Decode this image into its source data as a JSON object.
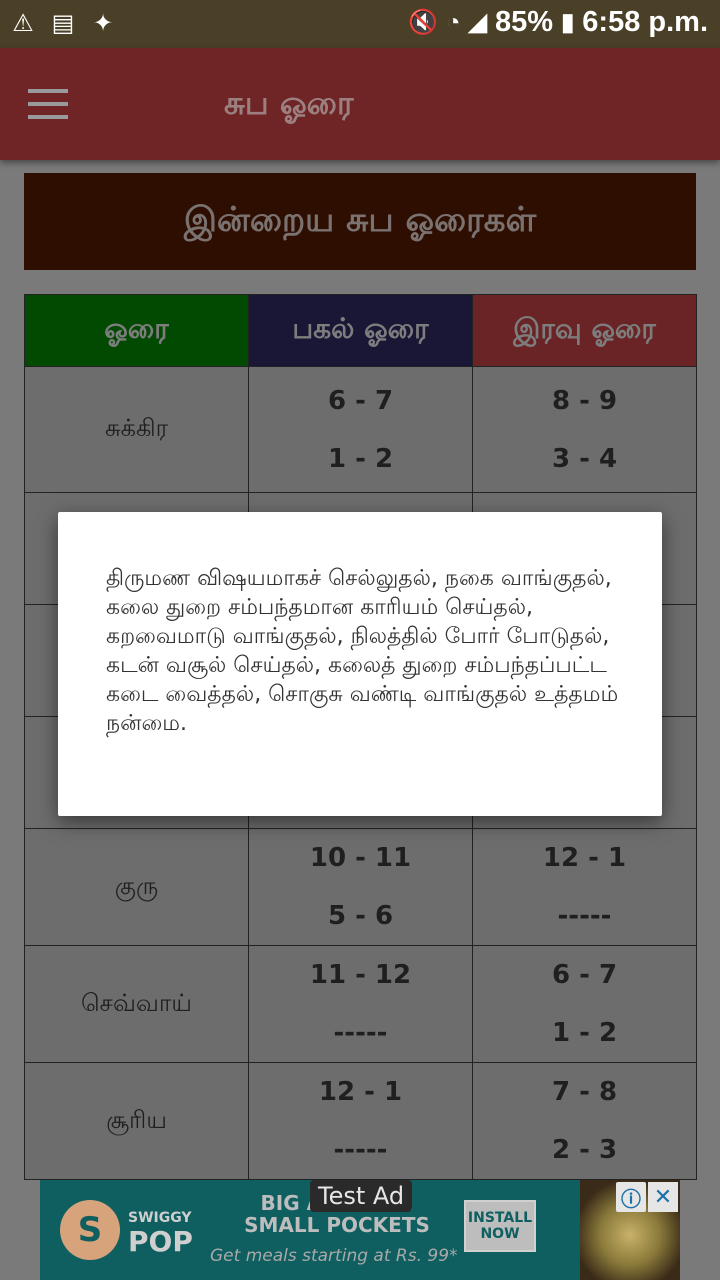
{
  "status_bar": {
    "icons_left": [
      "warning-icon",
      "document-icon",
      "magic-wand-icon"
    ],
    "battery": "85%",
    "time": "6:58 p.m."
  },
  "app_bar": {
    "title": "சுப ஓரை"
  },
  "banner": {
    "title": "இன்றைய சுப ஓரைகள்"
  },
  "table": {
    "headers": [
      "ஓரை",
      "பகல் ஓரை",
      "இரவு ஓரை"
    ],
    "header_colors": [
      "#024a02",
      "#191636",
      "#6a2426"
    ],
    "rows": [
      {
        "planet": "சுக்கிர",
        "day": [
          "6 - 7",
          "1 - 2"
        ],
        "night": [
          "8 - 9",
          "3 - 4"
        ]
      },
      {
        "planet": "",
        "day": [
          "",
          ""
        ],
        "night": [
          "",
          ""
        ]
      },
      {
        "planet": "",
        "day": [
          "",
          ""
        ],
        "night": [
          "",
          ""
        ]
      },
      {
        "planet": "",
        "day": [
          "",
          ""
        ],
        "night": [
          "",
          ""
        ]
      },
      {
        "planet": "குரு",
        "day": [
          "10 - 11",
          "5 - 6"
        ],
        "night": [
          "12 - 1",
          "-----"
        ]
      },
      {
        "planet": "செவ்வாய்",
        "day": [
          "11 - 12",
          "-----"
        ],
        "night": [
          "6 - 7",
          "1 - 2"
        ]
      },
      {
        "planet": "சூரிய",
        "day": [
          "12 - 1",
          "-----"
        ],
        "night": [
          "7 - 8",
          "2 - 3"
        ]
      }
    ]
  },
  "dialog": {
    "text": "திருமண விஷயமாகச் செல்லுதல், நகை வாங்குதல், கலை துறை சம்பந்தமான காரியம் செய்தல், கறவைமாடு வாங்குதல், நிலத்தில் போர் போடுதல், கடன் வசூல் செய்தல், கலைத் துறை சம்பந்தப்பட்ட கடை வைத்தல், சொகுசு வண்டி வாங்குதல் உத்தமம் நன்மை."
  },
  "ad": {
    "label": "Test Ad",
    "brand_small": "SWIGGY",
    "brand_big": "POP",
    "headline": "BIG APPETITE SMALL POCKETS",
    "sub": "Get meals starting at Rs. 99*",
    "install": "INSTALL NOW",
    "info_icon": "info-icon",
    "close_icon": "close-icon"
  }
}
